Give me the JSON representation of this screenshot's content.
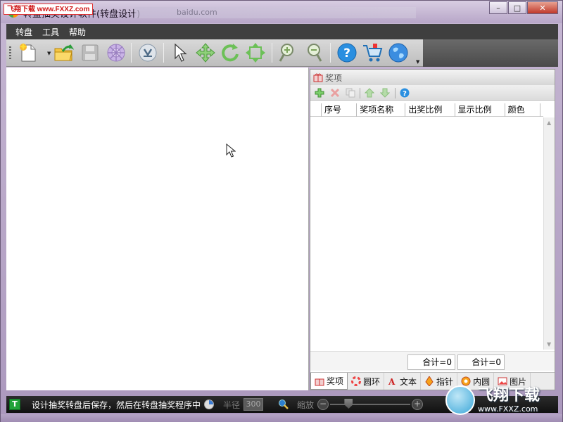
{
  "window": {
    "title": "转盘抽奖设计软件(转盘设计)",
    "title_blur_text": "baidu.com",
    "minimize": "–",
    "maximize": "□",
    "close": "✕",
    "overlay_badge": "飞翔下载 www.FXXZ.com"
  },
  "menu": {
    "items": [
      "转盘",
      "工具",
      "帮助"
    ]
  },
  "toolbar": {
    "icons": [
      "new-file-icon",
      "open-folder-icon",
      "save-disk-icon",
      "wheel-design-icon",
      "download-icon",
      "select-pointer-icon",
      "move-icon",
      "rotate-icon",
      "resize-icon",
      "zoom-in-icon",
      "zoom-out-icon",
      "help-icon",
      "cart-icon",
      "globe-icon"
    ]
  },
  "panel": {
    "title": "奖项",
    "columns": [
      "",
      "序号",
      "奖项名称",
      "出奖比例",
      "显示比例",
      "颜色",
      ""
    ],
    "rows": [],
    "total_1": "合计=0",
    "total_2": "合计=0",
    "tabs": [
      {
        "label": "奖项",
        "active": true
      },
      {
        "label": "圆环",
        "active": false
      },
      {
        "label": "文本",
        "active": false
      },
      {
        "label": "指针",
        "active": false
      },
      {
        "label": "内圆",
        "active": false
      },
      {
        "label": "图片",
        "active": false
      }
    ]
  },
  "status": {
    "icon_text": "T",
    "message": "设计抽奖转盘后保存，然后在转盘抽奖程序中",
    "radius_label": "半径",
    "radius_value": "300",
    "zoom_label": "缩放",
    "zoom_level": 0.2,
    "minus": "−",
    "plus": "+"
  },
  "watermark": {
    "name": "飞翔下载",
    "url": "www.FXXZ.com"
  },
  "colors": {
    "menubar": "#3f3f3f",
    "statusbar": "#1e1e1e",
    "frame": "#b8a8c8"
  }
}
